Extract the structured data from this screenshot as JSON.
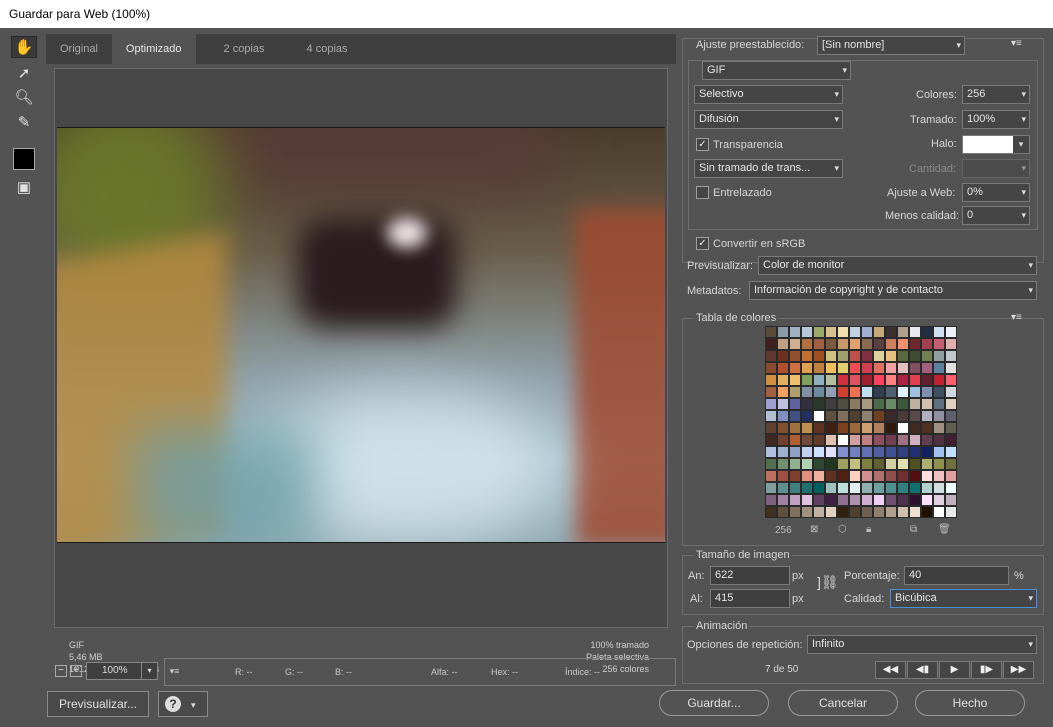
{
  "window": {
    "title": "Guardar para Web (100%)"
  },
  "tabs": [
    "Original",
    "Optimizado",
    "2 copias",
    "4 copias"
  ],
  "image_info": {
    "format": "GIF",
    "size": "5,46 MB",
    "time": "1012 seg. a 56,6 Kbps",
    "dither": "100% tramado",
    "palette": "Paleta selectiva",
    "colors": "256 colores"
  },
  "zoom": "100%",
  "readouts": {
    "r": "R: --",
    "g": "G: --",
    "b": "B: --",
    "alpha": "Alfa: --",
    "hex": "Hex: --",
    "index": "Índice: --"
  },
  "buttons": {
    "preview": "Previsualizar...",
    "save": "Guardar...",
    "cancel": "Cancelar",
    "done": "Hecho",
    "help_icon": "?"
  },
  "settings": {
    "preset_label": "Ajuste preestablecido:",
    "preset_value": "[Sin nombre]",
    "format_value": "GIF",
    "reduction_value": "Selectivo",
    "colors_label": "Colores:",
    "colors_value": "256",
    "dither_algo_value": "Difusión",
    "dither_label": "Tramado:",
    "dither_value": "100%",
    "transparency_label": "Transparencia",
    "matte_label": "Halo:",
    "trans_dither_value": "Sin tramado de trans...",
    "amount_label": "Cantidad:",
    "interlaced_label": "Entrelazado",
    "websnap_label": "Ajuste a Web:",
    "websnap_value": "0%",
    "lossy_label": "Menos calidad:",
    "lossy_value": "0",
    "convert_srgb_label": "Convertir en sRGB",
    "preview_label": "Previsualizar:",
    "preview_value": "Color de monitor",
    "metadata_label": "Metadatos:",
    "metadata_value": "Información de copyright y de contacto"
  },
  "color_table": {
    "title": "Tabla de colores",
    "count": "256",
    "colors": [
      "#5a4a3a",
      "#8a9aa8",
      "#a0b0c0",
      "#b8c8d8",
      "#9aaa6a",
      "#d8c090",
      "#f0e0b0",
      "#c0d0e0",
      "#a0b0d0",
      "#c8a878",
      "#3a3030",
      "#b0a090",
      "#e8e8f0",
      "#203040",
      "#d0e0f0",
      "#f0f0f8",
      "#402020",
      "#c0a080",
      "#d0b090",
      "#b07040",
      "#a06040",
      "#7a5a40",
      "#c89868",
      "#e0a070",
      "#8a6a50",
      "#5a4040",
      "#d08060",
      "#f09070",
      "#702830",
      "#a04050",
      "#c06070",
      "#e0b0b0",
      "#603830",
      "#703020",
      "#905030",
      "#c07030",
      "#a05020",
      "#d0c080",
      "#a0a070",
      "#c05050",
      "#803040",
      "#e0d0a0",
      "#e8c080",
      "#5a6a40",
      "#404a30",
      "#708050",
      "#90a0a0",
      "#c0c8d0",
      "#8a4a30",
      "#b05030",
      "#d07040",
      "#e0a050",
      "#c08040",
      "#f0c060",
      "#e0d070",
      "#f05050",
      "#d04050",
      "#e07060",
      "#f0a0a0",
      "#e0c0c0",
      "#805060",
      "#a06080",
      "#6080a0",
      "#e0e0e0",
      "#d09040",
      "#e0b060",
      "#f0c070",
      "#80a060",
      "#90b0c0",
      "#b0c0a0",
      "#d03040",
      "#e05060",
      "#a02030",
      "#ff4060",
      "#ff8080",
      "#b02040",
      "#e04050",
      "#602030",
      "#c02030",
      "#ff6070",
      "#a06040",
      "#f0a060",
      "#b0a070",
      "#8090a0",
      "#6a8aa0",
      "#90a0b0",
      "#d04030",
      "#f07050",
      "#c0e0f0",
      "#304050",
      "#506070",
      "#e0f0ff",
      "#a0c0e0",
      "#8090b0",
      "#405060",
      "#d0d8e0",
      "#a0a0d0",
      "#c0c0e0",
      "#6060a0",
      "#303040",
      "#2a3a2a",
      "#404040",
      "#505040",
      "#8a7a60",
      "#aa9a80",
      "#4a6a4a",
      "#6a8a6a",
      "#3a5a3a",
      "#c0b0a0",
      "#d0c0b0",
      "#607080",
      "#e0d0c0",
      "#b0c0d0",
      "#8090c0",
      "#405080",
      "#203060",
      "#ffffff",
      "#605040",
      "#807060",
      "#504030",
      "#908070",
      "#704020",
      "#3a2a2a",
      "#4a3a3a",
      "#5a4a4a",
      "#b0b0c0",
      "#9090a0",
      "#606070",
      "#604030",
      "#805030",
      "#a07040",
      "#c09050",
      "#603020",
      "#402010",
      "#804020",
      "#9a6a3a",
      "#d0a070",
      "#b08060",
      "#301a10",
      "#ffffff",
      "#402a20",
      "#503020",
      "#a09080",
      "#606050",
      "#402820",
      "#704030",
      "#b06030",
      "#704a3a",
      "#603a2a",
      "#e0c0b0",
      "#ffffff",
      "#d0a0a0",
      "#c08080",
      "#905060",
      "#704050",
      "#a07080",
      "#d0b0c0",
      "#604050",
      "#503040",
      "#402030",
      "#b0c0e0",
      "#a0b0d0",
      "#90a0c0",
      "#c0d0f0",
      "#d0e0ff",
      "#e0e0ff",
      "#8090d0",
      "#7080c0",
      "#6070b0",
      "#5060a0",
      "#405090",
      "#304080",
      "#203070",
      "#102060",
      "#a0c0f0",
      "#c0e0ff",
      "#507050",
      "#709070",
      "#90b090",
      "#b0d0b0",
      "#304830",
      "#203820",
      "#a0a060",
      "#c0c080",
      "#808040",
      "#606030",
      "#d0d0a0",
      "#e0e0b0",
      "#505020",
      "#b0b070",
      "#909050",
      "#707040",
      "#c07060",
      "#a05040",
      "#804030",
      "#e09080",
      "#f0b0a0",
      "#603020",
      "#502010",
      "#ffd0c0",
      "#d09090",
      "#b07070",
      "#905050",
      "#703030",
      "#501010",
      "#ffe0e0",
      "#f0c0c0",
      "#e0a0a0",
      "#80a0a0",
      "#609090",
      "#408080",
      "#207070",
      "#006060",
      "#a0c0c0",
      "#c0e0e0",
      "#e0f0f0",
      "#90b0b0",
      "#70a0a0",
      "#509090",
      "#308080",
      "#107070",
      "#b0d0d0",
      "#d0e0e0",
      "#f0ffff",
      "#806080",
      "#a080a0",
      "#c0a0c0",
      "#e0c0e0",
      "#604060",
      "#402040",
      "#907090",
      "#b090b0",
      "#d0b0d0",
      "#f0d0f0",
      "#705070",
      "#503050",
      "#301030",
      "#ffe0ff",
      "#e0d0e0",
      "#c0b0c0",
      "#403020",
      "#605040",
      "#807060",
      "#a09080",
      "#c0b0a0",
      "#e0d0c0",
      "#302010",
      "#504030",
      "#706050",
      "#908070",
      "#b0a090",
      "#d0c0b0",
      "#f0e0d0",
      "#201000",
      "#ffffff",
      "#e8e8e8"
    ]
  },
  "image_size": {
    "title": "Tamaño de imagen",
    "width_label": "An:",
    "width_value": "622",
    "height_label": "Al:",
    "height_value": "415",
    "unit": "px",
    "percent_label": "Porcentaje:",
    "percent_value": "40",
    "percent_unit": "%",
    "quality_label": "Calidad:",
    "quality_value": "Bicúbica"
  },
  "animation": {
    "title": "Animación",
    "loop_label": "Opciones de repetición:",
    "loop_value": "Infinito",
    "frame_counter": "7 de 50",
    "controls": [
      "◀◀",
      "◀▮",
      "▶",
      "▮▶",
      "▶▶"
    ]
  }
}
